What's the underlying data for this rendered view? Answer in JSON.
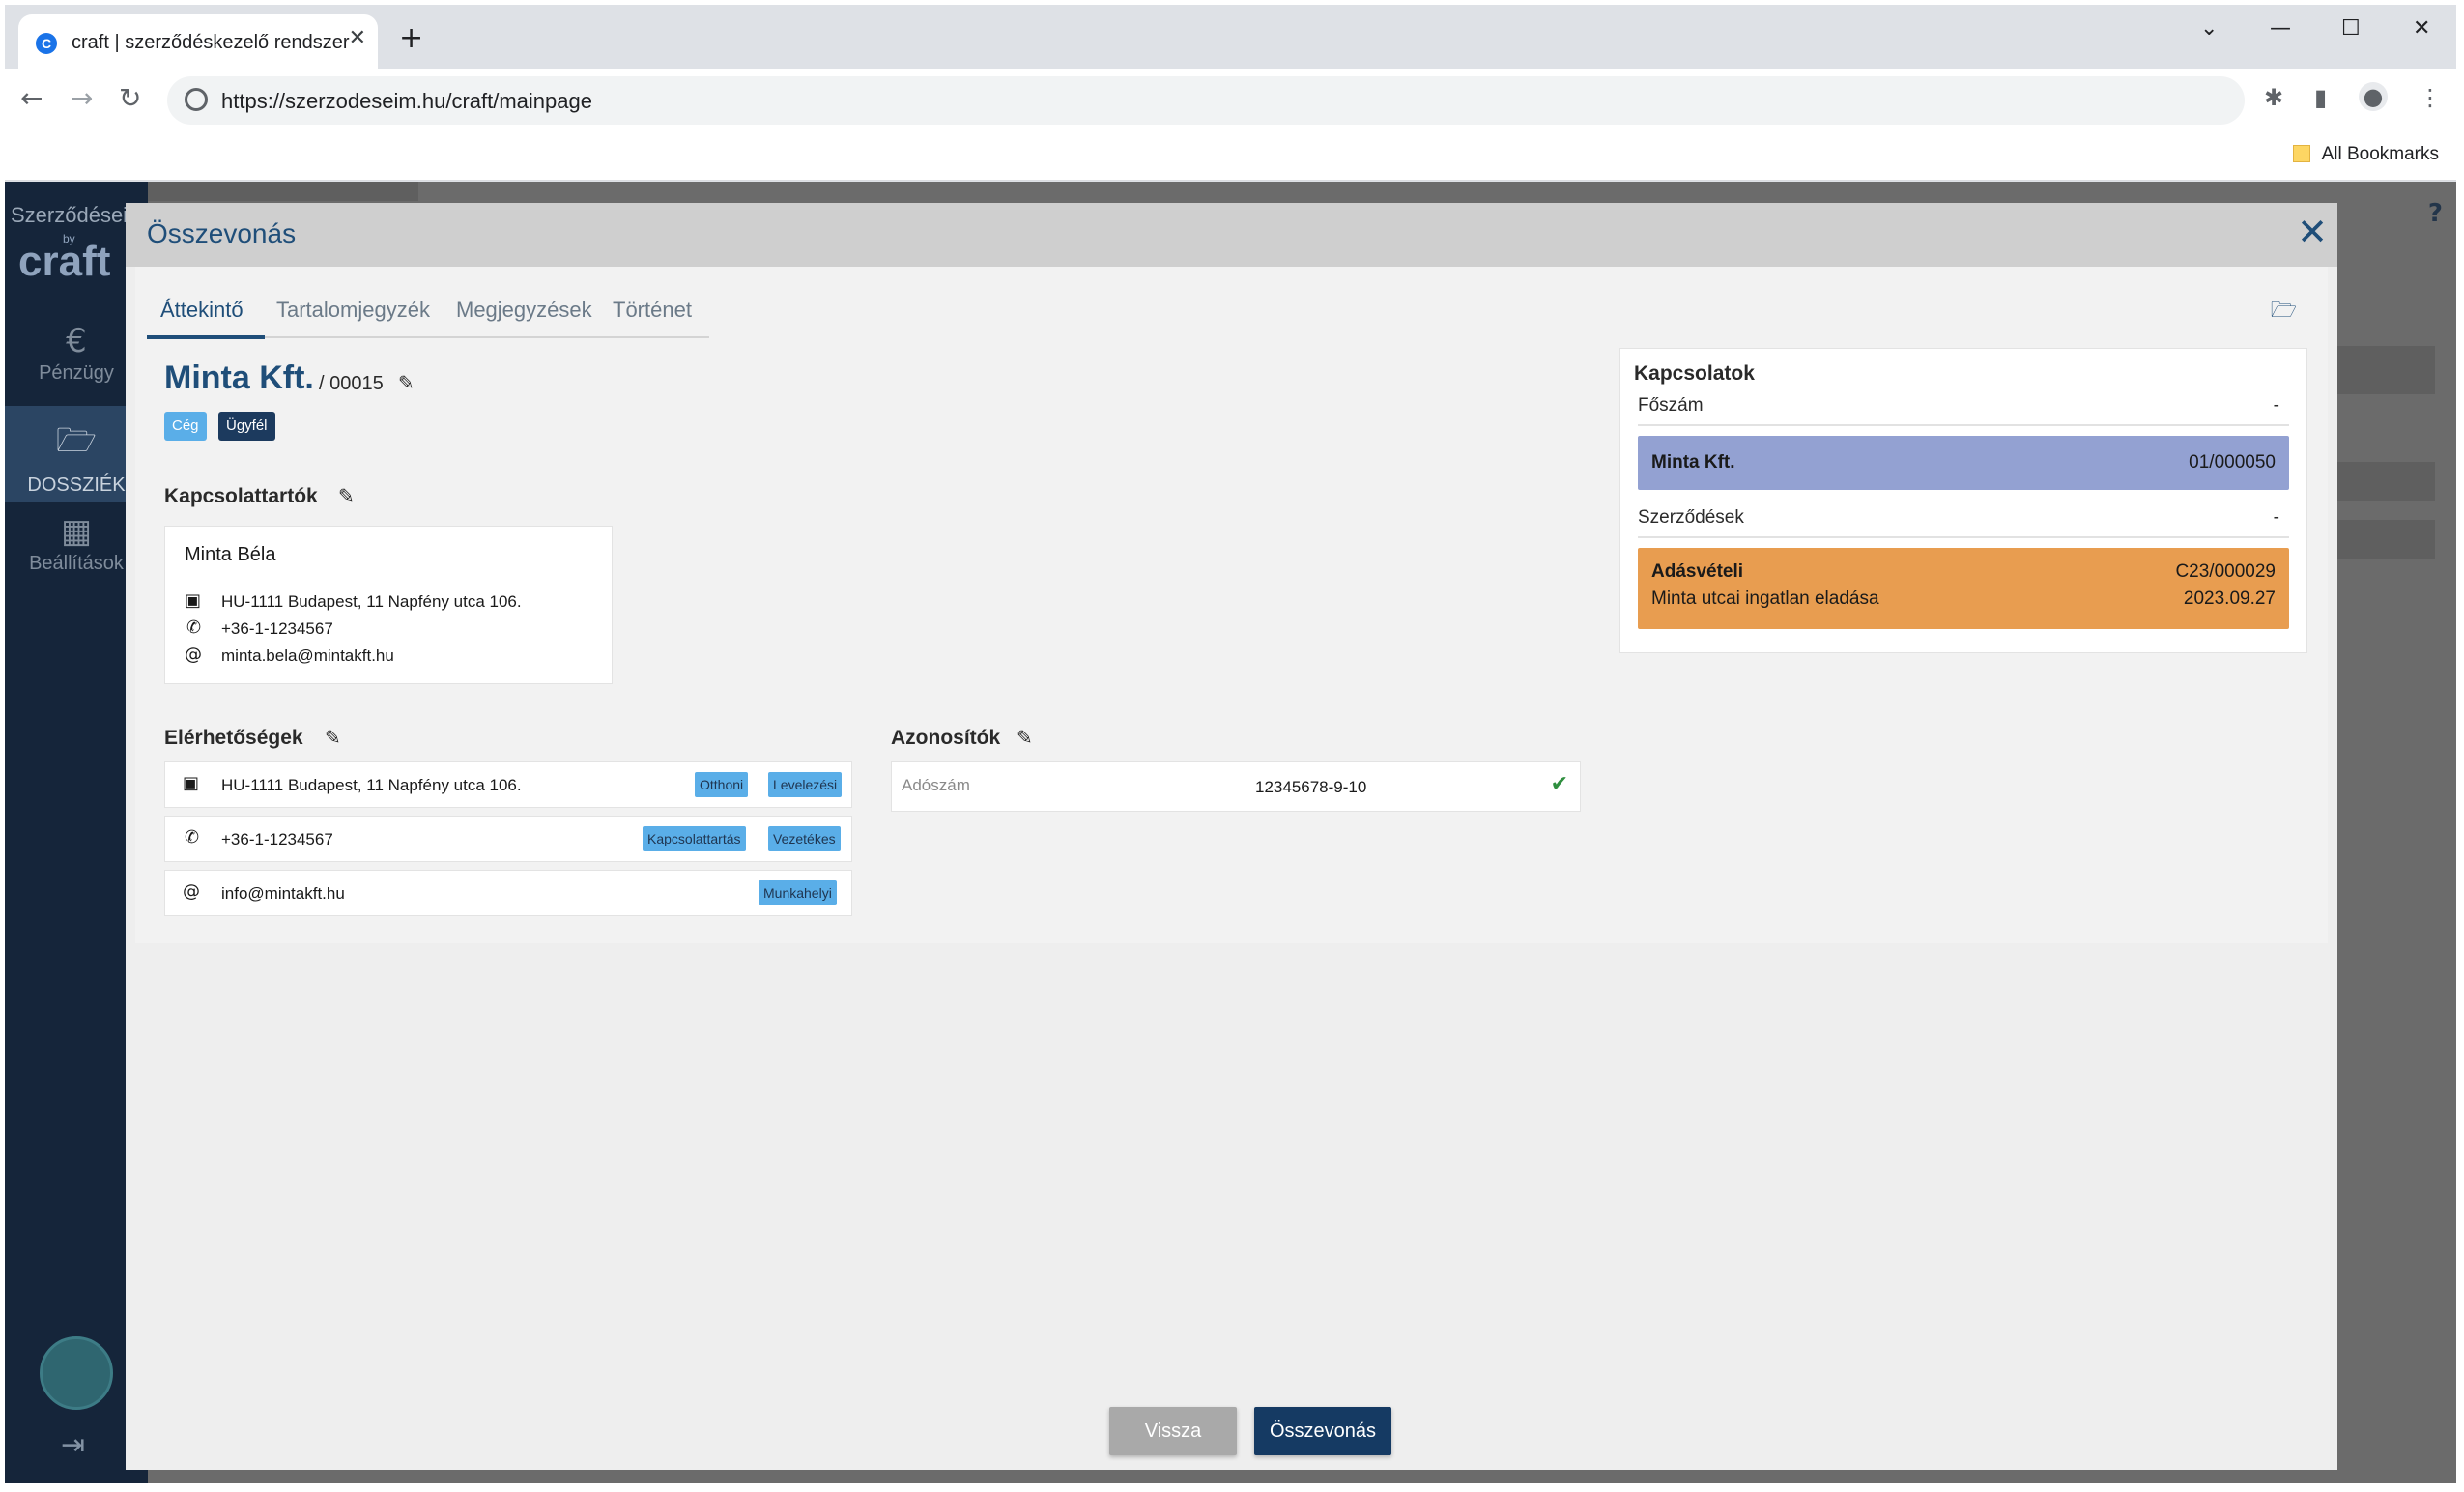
{
  "browser": {
    "tab_title": "craft | szerződéskezelő rendszer",
    "url": "https://szerzodeseim.hu/craft/mainpage",
    "bookmarks_label": "All Bookmarks"
  },
  "sidebar": {
    "logo_text": "Szerződései",
    "logo_by": "by",
    "logo_brand": "craft",
    "items": [
      {
        "label": "Pénzügy",
        "icon": "euro-icon"
      },
      {
        "label": "DOSSZIÉK",
        "icon": "folder-open-icon"
      },
      {
        "label": "Beállítások",
        "icon": "building-icon"
      }
    ]
  },
  "modal": {
    "title": "Összevonás",
    "tabs": [
      "Áttekintő",
      "Tartalomjegyzék",
      "Megjegyzések",
      "Történet"
    ],
    "company": {
      "name": "Minta Kft.",
      "code": "/ 00015",
      "badges": [
        "Cég",
        "Ügyfél"
      ]
    },
    "contacts": {
      "title": "Kapcsolattartók",
      "person": {
        "name": "Minta Béla",
        "address": "HU-1111 Budapest, 11 Napfény utca 106.",
        "phone": "+36-1-1234567",
        "email": "minta.bela@mintakft.hu"
      }
    },
    "reachability": {
      "title": "Elérhetőségek",
      "rows": [
        {
          "text": "HU-1111 Budapest, 11 Napfény utca 106.",
          "tags": [
            "Otthoni",
            "Levelezési"
          ]
        },
        {
          "text": "+36-1-1234567",
          "tags": [
            "Kapcsolattartás",
            "Vezetékes"
          ]
        },
        {
          "text": "info@mintakft.hu",
          "tags": [
            "Munkahelyi"
          ]
        }
      ]
    },
    "identifiers": {
      "title": "Azonosítók",
      "rows": [
        {
          "label": "Adószám",
          "value": "12345678-9-10"
        }
      ]
    },
    "relations": {
      "title": "Kapcsolatok",
      "main_label": "Főszám",
      "main_value": "-",
      "main_block": {
        "name": "Minta Kft.",
        "number": "01/000050"
      },
      "contracts_label": "Szerződések",
      "contracts_value": "-",
      "contract_block": {
        "type": "Adásvételi",
        "description": "Minta utcai ingatlan eladása",
        "number": "C23/000029",
        "date": "2023.09.27"
      }
    },
    "buttons": {
      "back": "Vissza",
      "merge": "Összevonás"
    }
  },
  "colors": {
    "primary": "#1f4e79",
    "tag_blue": "#5aaee8",
    "badge_dark": "#1c3a5e",
    "relation_purple": "#93a1d2",
    "relation_orange": "#e89d50",
    "button_grey": "#a9a9a9",
    "button_navy": "#153a63"
  }
}
